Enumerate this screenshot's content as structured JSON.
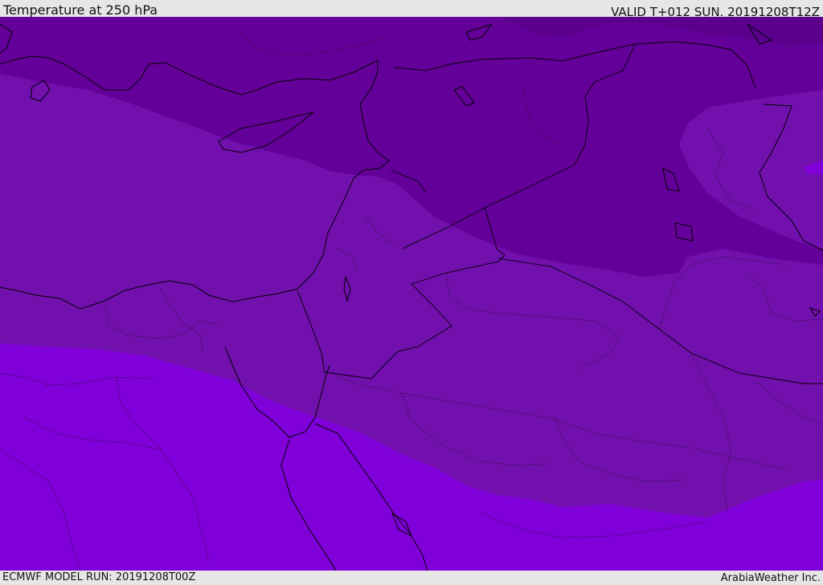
{
  "header": {
    "title": "Temperature at 250 hPa",
    "valid": "VALID T+012 SUN. 20191208T12Z"
  },
  "footer": {
    "model_run": "ECMWF MODEL RUN: 20191208T00Z",
    "credit": "ArabiaWeather Inc."
  },
  "colors": {
    "band_darkest": "#5a008c",
    "band_dark": "#64009a",
    "band_mid": "#7210ae",
    "band_light": "#7f00d8",
    "coast": "#000000",
    "border": "#000000"
  }
}
